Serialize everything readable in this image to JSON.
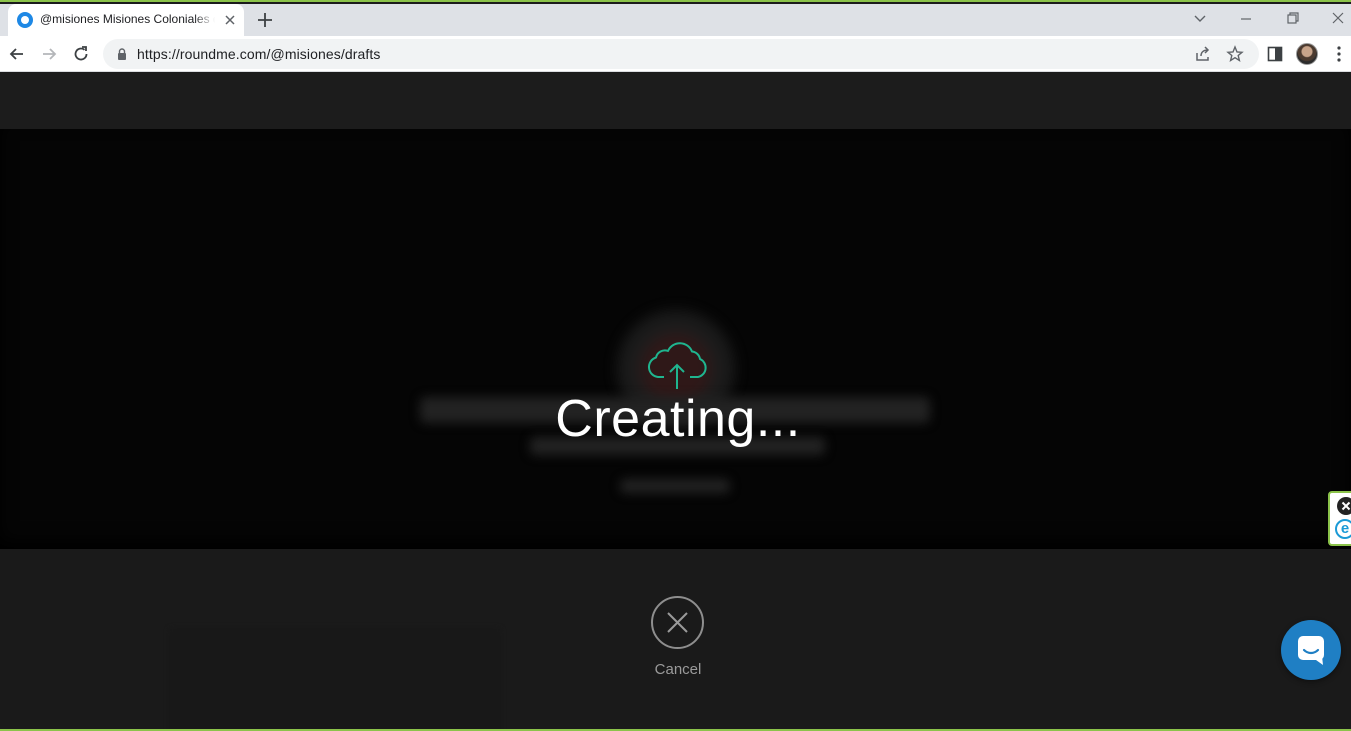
{
  "browser": {
    "tab_title": "@misiones Misiones Coloniales de Chihuahua",
    "url": "https://roundme.com/@misiones/drafts",
    "accent_color": "#8bc34a"
  },
  "overlay": {
    "status_text": "Creating...",
    "icon": "cloud-upload-icon",
    "icon_color": "#1fb58f",
    "cancel_label": "Cancel"
  },
  "widgets": {
    "edge_badge_letter": "e",
    "chat_color": "#1f7fc4"
  }
}
